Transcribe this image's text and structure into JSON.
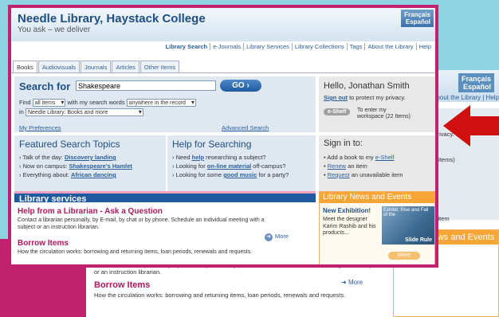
{
  "site": {
    "title": "Needle Library, Haystack College",
    "tagline": "You ask – we deliver",
    "languages": [
      "Français",
      "Español"
    ]
  },
  "topnav": [
    "Library Search",
    "e-Journals",
    "Library Services",
    "Library Collections",
    "Tags",
    "About the Library",
    "Help"
  ],
  "tabs": [
    "Books",
    "Audiovisuals",
    "Journals",
    "Articles",
    "Other Items"
  ],
  "search": {
    "title": "Search for",
    "value": "Shakespeare",
    "go_label": "GO",
    "find_label": "Find",
    "find_select": "all items",
    "mid_label": "with my search words",
    "where_select": "anywhere in the record",
    "in_label": "in",
    "scope_select": "Needle Library: Books and more",
    "preferences_link": "My Preferences",
    "advanced_link": "Advanced Search"
  },
  "user": {
    "greeting": "Hello, Jonathan Smith",
    "signout_link": "Sign out",
    "signout_suffix": "to protect my privacy.",
    "eshelf_label": "e-Shelf",
    "eshelf_text_1": "To enter my",
    "eshelf_text_2": "workspace (22 Items)"
  },
  "featured": {
    "title": "Featured Search Topics",
    "items": [
      {
        "prefix": "› Talk of the day: ",
        "link": "Discovery landing"
      },
      {
        "prefix": "› Now on campus: ",
        "link": "Shakespeare's Hamlet"
      },
      {
        "prefix": "› Everything about: ",
        "link": "African dancing"
      }
    ]
  },
  "help": {
    "title": "Help for Searching",
    "items": [
      {
        "prefix": "› Need ",
        "link": "help",
        "suffix": " researching a subject?"
      },
      {
        "prefix": "› Looking for ",
        "link": "on-line material",
        "suffix": " off-campus?"
      },
      {
        "prefix": "› Looking for some ",
        "link": "good music",
        "suffix": " for a party?"
      }
    ]
  },
  "signin": {
    "title": "Sign in to:",
    "items": [
      {
        "prefix": "• Add a book to my ",
        "link": "e-Shelf",
        "suffix": ""
      },
      {
        "prefix": "• ",
        "link": "Renew",
        "suffix": " an item"
      },
      {
        "prefix": "• ",
        "link": "Request",
        "suffix": " an unavailable item"
      }
    ]
  },
  "services": {
    "title": "Library services",
    "help_title": "Help from a Librarian - Ask a Question",
    "help_text": "Contact a librarian personally, by E-mail, by chat or by phone. Schedule an individual meeting with a subject or an instruction librarian.",
    "more_label": "More",
    "borrow_title": "Borrow Items",
    "borrow_text": "How the circulation works: borrowing and returning items, loan periods, renewals and requests."
  },
  "news": {
    "title": "Library News and Events",
    "subtitle": "New Exhibition!",
    "text": "Meet the designer Karim Rashib and his products...",
    "image_caption": "Exhibit: Rise and Fall of the",
    "image_title": "Slide Rule",
    "more_label": "More"
  },
  "colors": {
    "brand": "#1e4e86",
    "accent": "#c0226f",
    "news": "#f7a535"
  }
}
